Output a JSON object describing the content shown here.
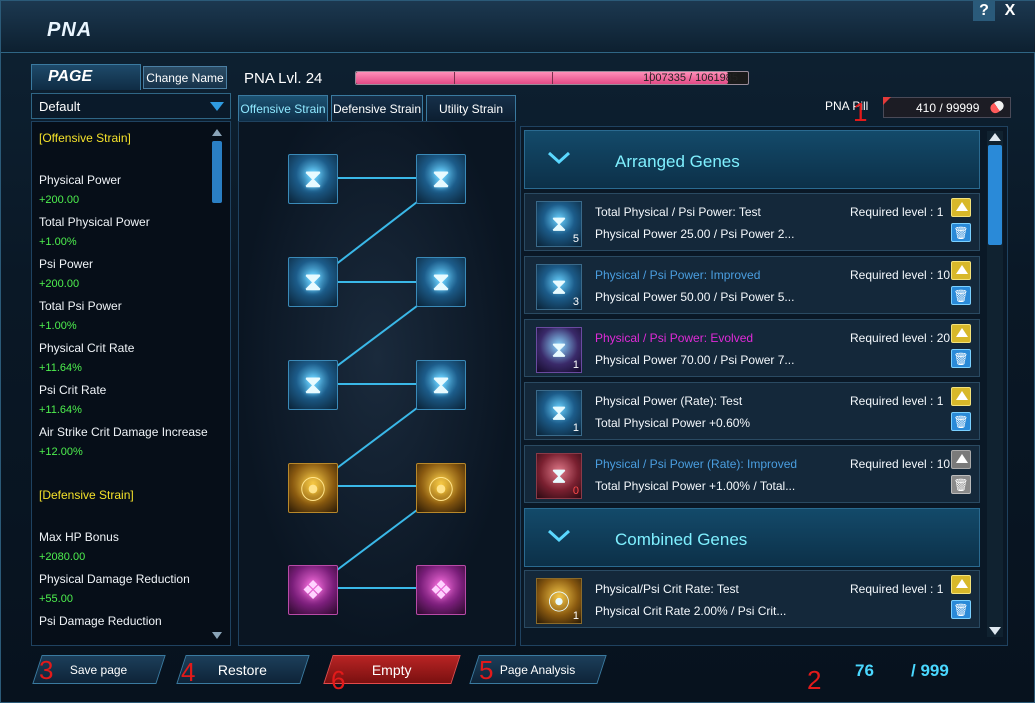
{
  "window": {
    "title": "PNA",
    "help_label": "?",
    "close_label": "X"
  },
  "page_panel": {
    "tab_label": "PAGE",
    "change_name_label": "Change Name",
    "selected_page": "Default",
    "stats": [
      {
        "type": "head",
        "text": "[Offensive Strain]"
      },
      {
        "type": "name",
        "text": "Physical Power"
      },
      {
        "type": "val",
        "text": "+200.00"
      },
      {
        "type": "name",
        "text": "Total Physical Power"
      },
      {
        "type": "val",
        "text": "+1.00%"
      },
      {
        "type": "name",
        "text": "Psi Power"
      },
      {
        "type": "val",
        "text": "+200.00"
      },
      {
        "type": "name",
        "text": "Total Psi Power"
      },
      {
        "type": "val",
        "text": "+1.00%"
      },
      {
        "type": "name",
        "text": "Physical Crit Rate"
      },
      {
        "type": "val",
        "text": "+11.64%"
      },
      {
        "type": "name",
        "text": "Psi Crit Rate"
      },
      {
        "type": "val",
        "text": "+11.64%"
      },
      {
        "type": "name",
        "text": "Air Strike Crit Damage Increase"
      },
      {
        "type": "val",
        "text": "+12.00%"
      },
      {
        "type": "head",
        "text": "[Defensive Strain]"
      },
      {
        "type": "name",
        "text": "Max HP Bonus"
      },
      {
        "type": "val",
        "text": "+2080.00"
      },
      {
        "type": "name",
        "text": "Physical Damage Reduction"
      },
      {
        "type": "val",
        "text": "+55.00"
      },
      {
        "type": "name",
        "text": "Psi Damage Reduction"
      }
    ]
  },
  "level": {
    "label": "PNA Lvl. 24",
    "xp_text": "1007335 / 1061985",
    "xp_fraction": 0.9485
  },
  "tabs": [
    {
      "label": "Offensive Strain",
      "active": true
    },
    {
      "label": "Defensive Strain",
      "active": false
    },
    {
      "label": "Utility Strain",
      "active": false
    }
  ],
  "pna_pill": {
    "label": "PNA Pill",
    "value": "410  /  99999"
  },
  "gene_sections": [
    {
      "label": "Arranged Genes"
    },
    {
      "label": "Combined Genes"
    }
  ],
  "genes": [
    {
      "name": "Total Physical / Psi Power: Test",
      "name_color": "white",
      "desc": "Physical Power  25.00 / Psi Power  2...",
      "req": "Required level : 1",
      "count": "5",
      "icon": "blue",
      "disabled": false
    },
    {
      "name": "Physical / Psi Power: Improved",
      "name_color": "blue",
      "desc": "Physical Power  50.00 / Psi Power  5...",
      "req": "Required level : 10",
      "count": "3",
      "icon": "blue",
      "disabled": false
    },
    {
      "name": "Physical / Psi Power: Evolved",
      "name_color": "pink",
      "desc": "Physical Power  70.00 / Psi Power  7...",
      "req": "Required level : 20",
      "count": "1",
      "icon": "purplebg",
      "disabled": false
    },
    {
      "name": "Physical Power (Rate): Test",
      "name_color": "white",
      "desc": "Total Physical Power  +0.60%",
      "req": "Required level : 1",
      "count": "1",
      "icon": "blue",
      "disabled": false
    },
    {
      "name": "Physical / Psi Power (Rate): Improved",
      "name_color": "blue",
      "desc": "Total Physical Power  +1.00% / Total...",
      "req": "Required level : 10",
      "count": "0",
      "icon": "red",
      "disabled": true
    }
  ],
  "combined_genes": [
    {
      "name": "Physical/Psi Crit Rate: Test",
      "name_color": "white",
      "desc": "Physical Crit Rate  2.00% / Psi Crit...",
      "req": "Required level : 1",
      "count": "1",
      "icon": "goldbg",
      "disabled": false
    }
  ],
  "bottom": {
    "save_label": "Save page",
    "restore_label": "Restore",
    "empty_label": "Empty",
    "analysis_label": "Page Analysis",
    "count_current": "76",
    "count_max": "/ 999"
  },
  "annotations": [
    "1",
    "2",
    "3",
    "4",
    "5",
    "6"
  ],
  "colors": {
    "accent": "#7ff0ff",
    "xp": "#e24a86",
    "stat_value": "#4ef04e",
    "stat_head": "#f4e12a",
    "annotation": "#e21a1a"
  }
}
